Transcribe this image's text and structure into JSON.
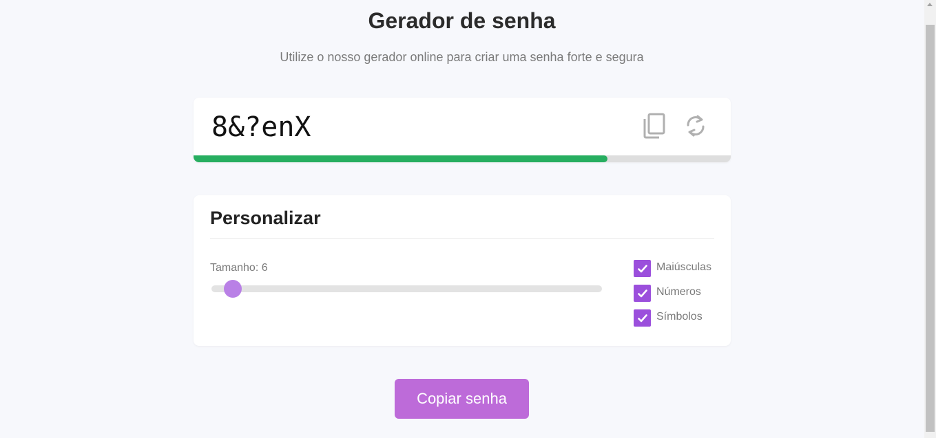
{
  "header": {
    "title": "Gerador de senha",
    "subtitle": "Utilize o nosso gerador online para criar uma senha forte e segura"
  },
  "password": {
    "value": "8&?enX",
    "strength": 0.77,
    "strength_color": "#27ae60",
    "icons": [
      "copy-icon",
      "refresh-icon"
    ]
  },
  "customize": {
    "title": "Personalizar",
    "length_label": "Tamanho: 6",
    "length_fraction": 0.055,
    "options": [
      {
        "label": "Maiúsculas",
        "checked": true
      },
      {
        "label": "Números",
        "checked": true
      },
      {
        "label": "Símbolos",
        "checked": true
      }
    ]
  },
  "actions": {
    "copy_label": "Copiar senha"
  },
  "colors": {
    "accent": "#bd6bd9",
    "checkbox": "#9b4fdc",
    "slider_thumb": "#b980e6"
  }
}
